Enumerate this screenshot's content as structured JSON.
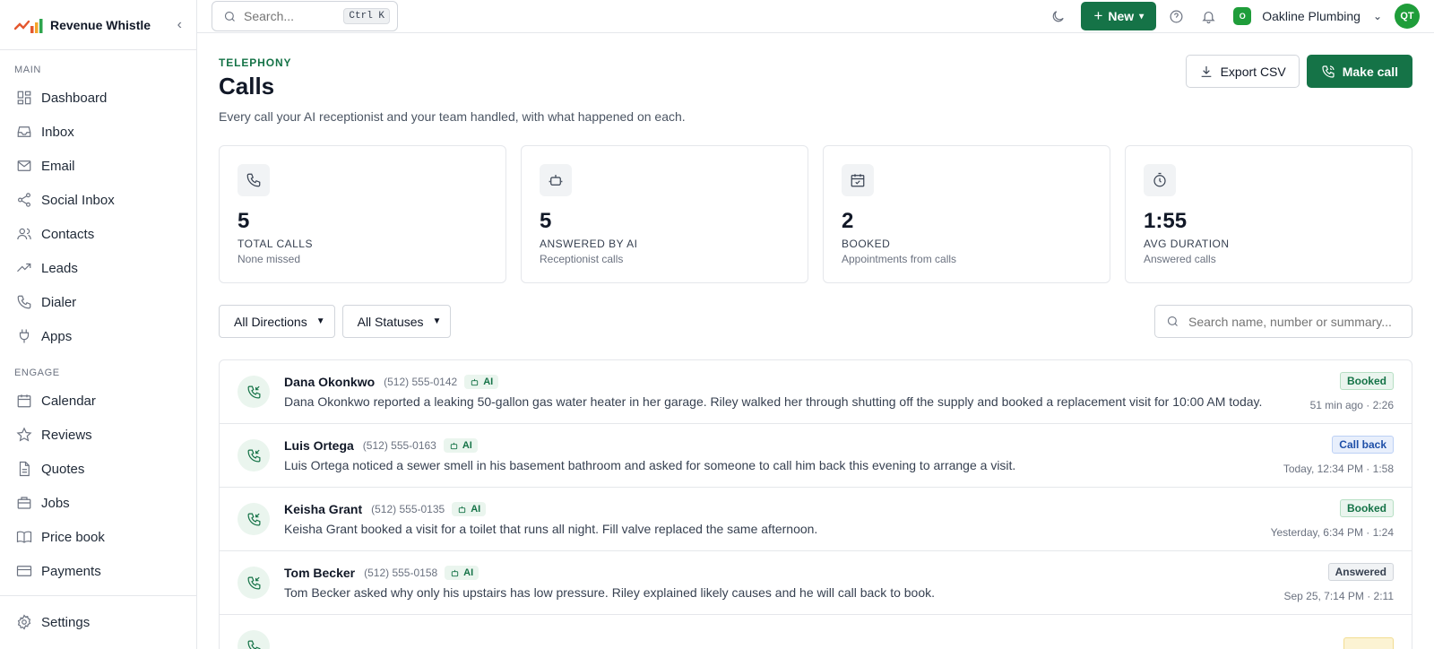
{
  "brand": {
    "name": "Revenue Whistle"
  },
  "sidebar": {
    "sections": [
      {
        "label": "MAIN",
        "items": [
          {
            "label": "Dashboard",
            "icon": "grid-icon"
          },
          {
            "label": "Inbox",
            "icon": "inbox-icon"
          },
          {
            "label": "Email",
            "icon": "mail-icon"
          },
          {
            "label": "Social Inbox",
            "icon": "share-icon"
          },
          {
            "label": "Contacts",
            "icon": "users-icon"
          },
          {
            "label": "Leads",
            "icon": "trending-icon"
          },
          {
            "label": "Dialer",
            "icon": "phone-icon"
          },
          {
            "label": "Apps",
            "icon": "plug-icon"
          }
        ]
      },
      {
        "label": "ENGAGE",
        "items": [
          {
            "label": "Calendar",
            "icon": "calendar-icon"
          },
          {
            "label": "Reviews",
            "icon": "star-icon"
          },
          {
            "label": "Quotes",
            "icon": "file-icon"
          },
          {
            "label": "Jobs",
            "icon": "briefcase-icon"
          },
          {
            "label": "Price book",
            "icon": "book-icon"
          },
          {
            "label": "Payments",
            "icon": "card-icon"
          }
        ]
      }
    ],
    "settings_label": "Settings"
  },
  "topbar": {
    "search_placeholder": "Search...",
    "search_shortcut": "Ctrl K",
    "new_label": "New",
    "org_initial": "O",
    "org_name": "Oakline Plumbing",
    "avatar_initials": "QT"
  },
  "page": {
    "eyebrow": "TELEPHONY",
    "title": "Calls",
    "subtitle": "Every call your AI receptionist and your team handled, with what happened on each.",
    "export_label": "Export CSV",
    "make_call_label": "Make call"
  },
  "stats": [
    {
      "value": "5",
      "label": "TOTAL CALLS",
      "sub": "None missed",
      "icon": "phone-icon"
    },
    {
      "value": "5",
      "label": "ANSWERED BY AI",
      "sub": "Receptionist calls",
      "icon": "bot-icon"
    },
    {
      "value": "2",
      "label": "BOOKED",
      "sub": "Appointments from calls",
      "icon": "calendar-check-icon"
    },
    {
      "value": "1:55",
      "label": "AVG DURATION",
      "sub": "Answered calls",
      "icon": "timer-icon"
    }
  ],
  "filters": {
    "direction": "All Directions",
    "status": "All Statuses",
    "search_placeholder": "Search name, number or summary..."
  },
  "calls": [
    {
      "name": "Dana Okonkwo",
      "phone": "(512) 555-0142",
      "ai": "AI",
      "summary": "Dana Okonkwo reported a leaking 50-gallon gas water heater in her garage. Riley walked her through shutting off the supply and booked a replacement visit for 10:00 AM today.",
      "status": "Booked",
      "status_kind": "booked",
      "meta": "51 min ago · 2:26"
    },
    {
      "name": "Luis Ortega",
      "phone": "(512) 555-0163",
      "ai": "AI",
      "summary": "Luis Ortega noticed a sewer smell in his basement bathroom and asked for someone to call him back this evening to arrange a visit.",
      "status": "Call back",
      "status_kind": "callback",
      "meta": "Today, 12:34 PM · 1:58"
    },
    {
      "name": "Keisha Grant",
      "phone": "(512) 555-0135",
      "ai": "AI",
      "summary": "Keisha Grant booked a visit for a toilet that runs all night. Fill valve replaced the same afternoon.",
      "status": "Booked",
      "status_kind": "booked",
      "meta": "Yesterday, 6:34 PM · 1:24"
    },
    {
      "name": "Tom Becker",
      "phone": "(512) 555-0158",
      "ai": "AI",
      "summary": "Tom Becker asked why only his upstairs has low pressure. Riley explained likely causes and he will call back to book.",
      "status": "Answered",
      "status_kind": "answered",
      "meta": "Sep 25, 7:14 PM · 2:11"
    }
  ],
  "colors": {
    "accent": "#157347",
    "accent_soft": "#eaf5ee",
    "callback": "#1e4fa8"
  }
}
